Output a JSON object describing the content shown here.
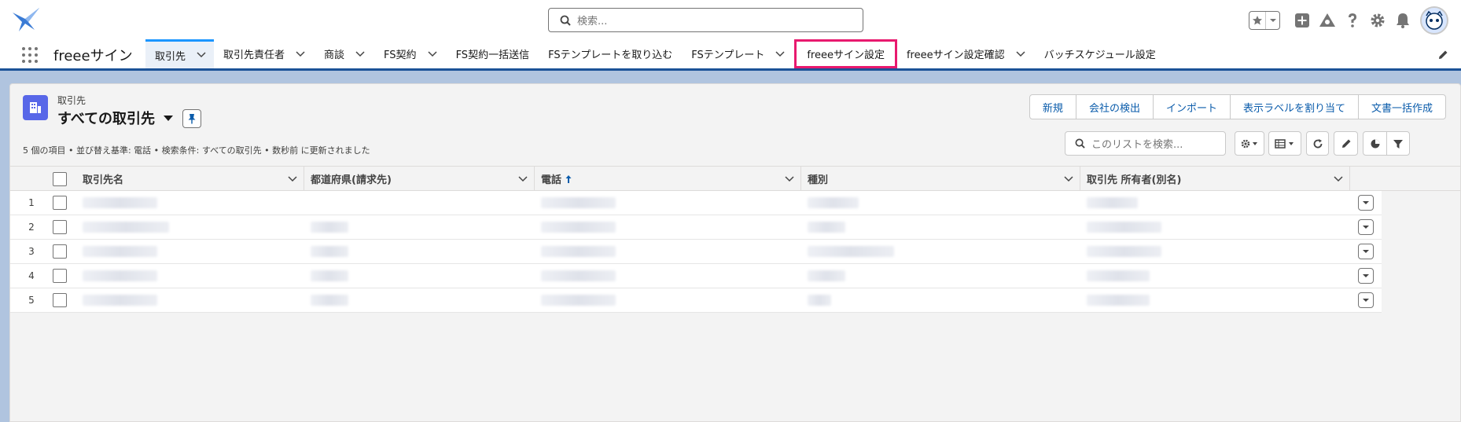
{
  "header": {
    "search_placeholder": "検索...",
    "icons": [
      "favorites-star-icon",
      "favorites-dropdown-icon",
      "global-add-icon",
      "trailhead-icon",
      "help-icon",
      "setup-gear-icon",
      "notifications-bell-icon",
      "user-avatar"
    ]
  },
  "nav": {
    "app_name": "freeeサイン",
    "tabs": [
      {
        "label": "取引先",
        "dropdown": true,
        "active": true
      },
      {
        "label": "取引先責任者",
        "dropdown": true
      },
      {
        "label": "商談",
        "dropdown": true
      },
      {
        "label": "FS契約",
        "dropdown": true
      },
      {
        "label": "FS契約一括送信",
        "dropdown": false
      },
      {
        "label": "FSテンプレートを取り込む",
        "dropdown": false
      },
      {
        "label": "FSテンプレート",
        "dropdown": true
      },
      {
        "label": "freeeサイン設定",
        "dropdown": false,
        "highlighted": true
      },
      {
        "label": "freeeサイン設定確認",
        "dropdown": true
      },
      {
        "label": "バッチスケジュール設定",
        "dropdown": false
      }
    ]
  },
  "list": {
    "object_label": "取引先",
    "title": "すべての取引先",
    "meta": "5 個の項目 • 並び替え基準: 電話 • 検索条件: すべての取引先 • 数秒前 に更新されました",
    "search_placeholder": "このリストを検索...",
    "actions": [
      "新規",
      "会社の検出",
      "インポート",
      "表示ラベルを割り当て",
      "文書一括作成"
    ],
    "columns": [
      {
        "label": "取引先名"
      },
      {
        "label": "都道府県(請求先)"
      },
      {
        "label": "電話",
        "sorted": "asc"
      },
      {
        "label": "種別"
      },
      {
        "label": "取引先 所有者(別名)"
      }
    ],
    "rows": [
      "1",
      "2",
      "3",
      "4",
      "5"
    ]
  },
  "colors": {
    "brand_blue": "#1b5297",
    "active_tab_border": "#1b96ff",
    "highlight": "#e8196e",
    "object_icon": "#5867e8",
    "link_blue": "#0b5cab"
  }
}
